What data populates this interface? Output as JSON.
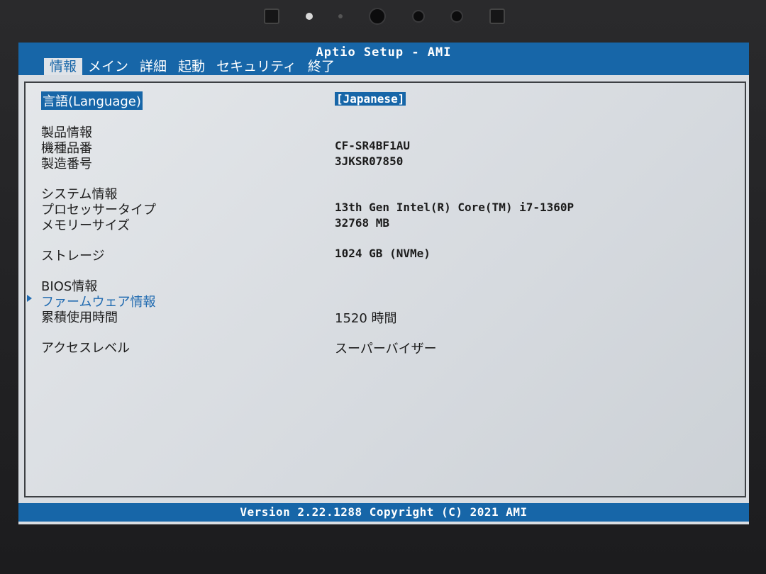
{
  "header": {
    "title": "Aptio Setup - AMI",
    "tabs": [
      "情報",
      "メイン",
      "詳細",
      "起動",
      "セキュリティ",
      "終了"
    ],
    "active_tab": "情報"
  },
  "main": {
    "language": {
      "label": "言語(Language)",
      "value": "[Japanese]"
    },
    "product_section": "製品情報",
    "model_number": {
      "label": "機種品番",
      "value": "CF-SR4BF1AU"
    },
    "serial_number": {
      "label": "製造番号",
      "value": "3JKSR07850"
    },
    "system_section": "システム情報",
    "processor": {
      "label": "プロセッサータイプ",
      "value": "13th Gen Intel(R) Core(TM) i7-1360P"
    },
    "memory": {
      "label": "メモリーサイズ",
      "value": "32768 MB"
    },
    "storage": {
      "label": "ストレージ",
      "value": "1024 GB (NVMe)"
    },
    "bios_section": "BIOS情報",
    "firmware": {
      "label": "ファームウェア情報"
    },
    "usage_time": {
      "label": "累積使用時間",
      "value": "1520 時間"
    },
    "access_level": {
      "label": "アクセスレベル",
      "value": "スーパーバイザー"
    }
  },
  "footer": {
    "text": "Version 2.22.1288 Copyright (C) 2021 AMI"
  },
  "colors": {
    "accent": "#1766a8",
    "screen_bg": "#d9dde2",
    "text": "#1c1c1c"
  }
}
